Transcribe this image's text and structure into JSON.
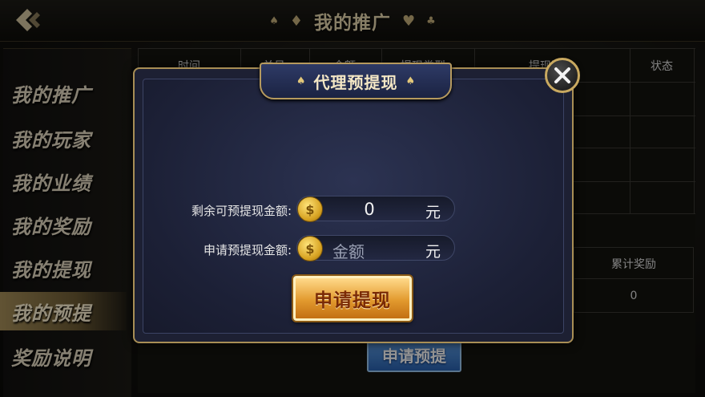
{
  "header": {
    "title": "我的推广"
  },
  "sidebar": {
    "items": [
      {
        "label": "我的推广",
        "active": false
      },
      {
        "label": "我的玩家",
        "active": false
      },
      {
        "label": "我的业绩",
        "active": false
      },
      {
        "label": "我的奖励",
        "active": false
      },
      {
        "label": "我的提现",
        "active": false
      },
      {
        "label": "我的预提",
        "active": true
      },
      {
        "label": "奖励说明",
        "active": false
      }
    ]
  },
  "table": {
    "columns": [
      "时间",
      "单号",
      "金额",
      "提现类型",
      "提现账号",
      "状态"
    ],
    "reward_header": "累计奖励",
    "reward_value": "0",
    "apply_button": "申请预提"
  },
  "modal": {
    "title": "代理预提现",
    "remaining_label": "剩余可预提现金额:",
    "remaining_value": "0",
    "remaining_unit": "元",
    "apply_label": "申请预提现金额:",
    "apply_placeholder": "金额",
    "apply_unit": "元",
    "submit_button": "申请提现"
  },
  "colors": {
    "accent_gold": "#c9a960",
    "active_tab": "#a8905a",
    "modal_bg": "#1d2033",
    "submit_orange": "#e29a2e",
    "bg_button_blue": "#2a63b2"
  }
}
